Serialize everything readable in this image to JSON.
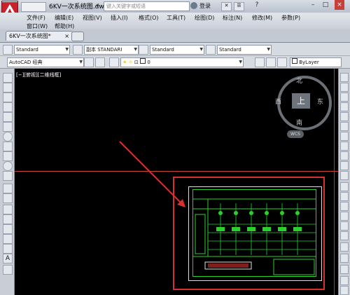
{
  "titlebar": {
    "doc_title": "6KV一次系统图.dwg",
    "search_placeholder": "键入关键字或短语",
    "login_label": "登录",
    "help": "?"
  },
  "menu": {
    "row1": [
      "文件(F)",
      "编辑(E)",
      "视图(V)",
      "插入(I)",
      "格式(O)",
      "工具(T)",
      "绘图(D)",
      "标注(N)",
      "修改(M)",
      "参数(P)"
    ],
    "row2": [
      "窗口(W)",
      "帮助(H)"
    ]
  },
  "tabs": {
    "active": "6KV一次系统图*",
    "close": "×"
  },
  "toolbar1": {
    "text_style": "Standard",
    "dim_style": "副本 STANDARI",
    "table_style": "Standard",
    "mleader_style": "Standard"
  },
  "toolbar2": {
    "workspace": "AutoCAD 经典",
    "layer": "0",
    "color": "ByLayer"
  },
  "viewport": {
    "label": "[−][俯视][二维线框]",
    "compass": {
      "north": "北",
      "south": "南",
      "east": "东",
      "west": "西",
      "center": "上"
    },
    "wcs": "WCS"
  },
  "colors": {
    "accent_red": "#d8302e",
    "drawing_green": "#2bd12b",
    "canvas_bg": "#000000"
  }
}
